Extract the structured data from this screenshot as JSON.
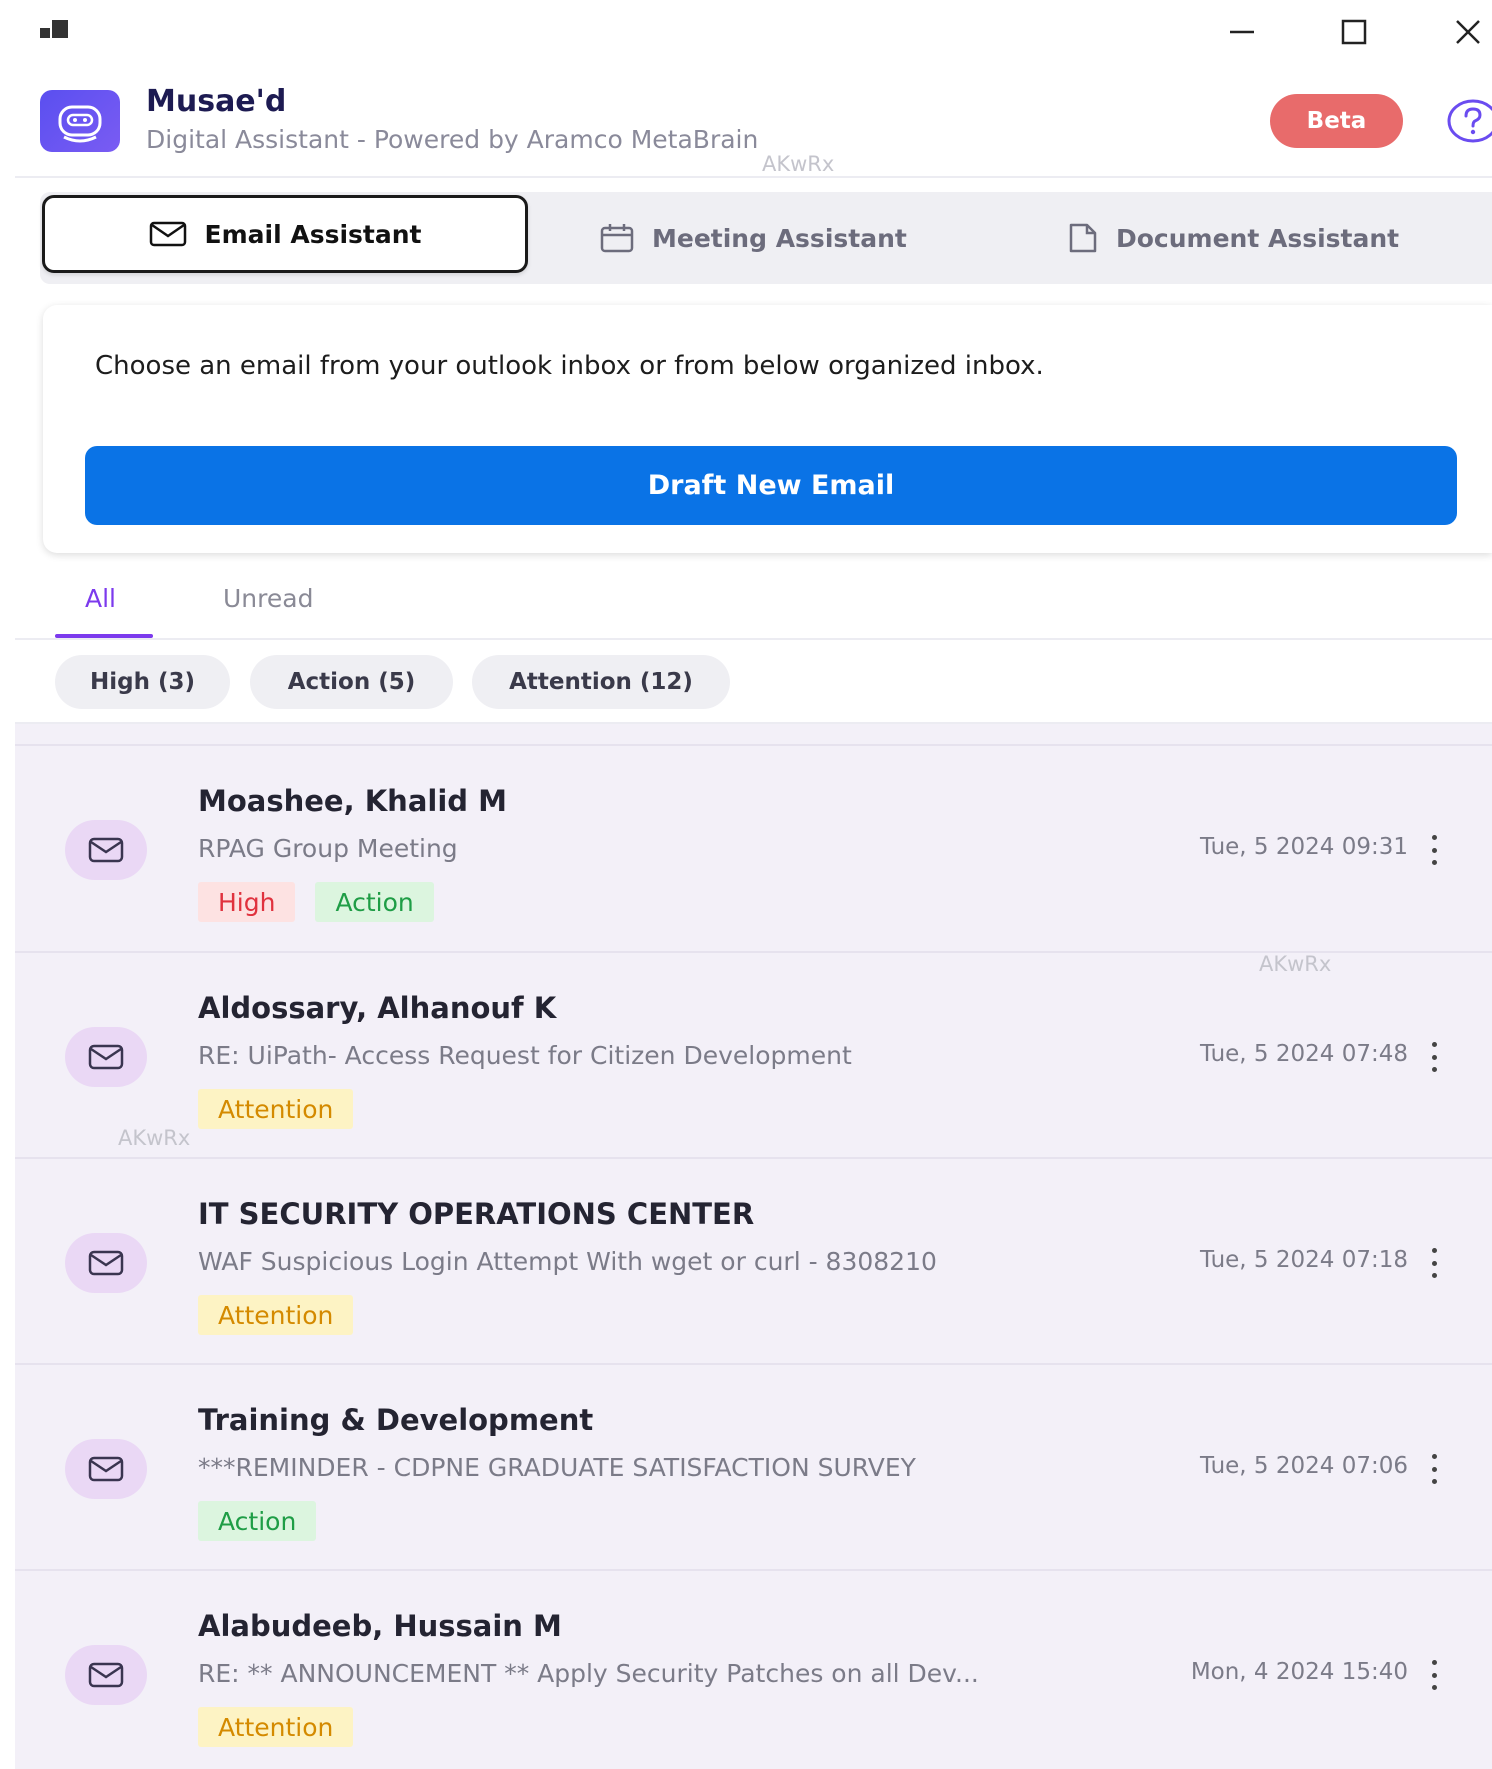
{
  "window": {
    "controls": {
      "minimize": "minimize-icon",
      "maximize": "maximize-icon",
      "close": "close-icon"
    }
  },
  "header": {
    "app_name": "Musae'd",
    "subtitle": "Digital Assistant - Powered by Aramco MetaBrain",
    "watermark": "AKwRx",
    "beta_label": "Beta",
    "help_icon": "help-circle-icon"
  },
  "tabs": [
    {
      "label": "Email Assistant",
      "icon": "mail-icon",
      "active": true
    },
    {
      "label": "Meeting Assistant",
      "icon": "calendar-icon",
      "active": false
    },
    {
      "label": "Document Assistant",
      "icon": "document-icon",
      "active": false
    }
  ],
  "intro": {
    "text": "Choose an email from your outlook inbox or from below organized inbox.",
    "draft_button": "Draft New Email"
  },
  "filters": {
    "tabs": [
      {
        "label": "All",
        "active": true
      },
      {
        "label": "Unread",
        "active": false
      }
    ],
    "chips": [
      "High (3)",
      "Action (5)",
      "Attention (12)"
    ]
  },
  "emails": [
    {
      "sender": "Moashee, Khalid M",
      "subject": "RPAG Group Meeting",
      "date": "Tue, 5 2024 09:31",
      "tags": [
        "High",
        "Action"
      ]
    },
    {
      "sender": "Aldossary, Alhanouf K",
      "subject": "RE: UiPath- Access Request for Citizen Development",
      "date": "Tue, 5 2024 07:48",
      "tags": [
        "Attention"
      ]
    },
    {
      "sender": "IT SECURITY OPERATIONS CENTER",
      "subject": "WAF Suspicious Login Attempt With wget or curl - 8308210",
      "date": "Tue, 5 2024 07:18",
      "tags": [
        "Attention"
      ]
    },
    {
      "sender": "Training & Development",
      "subject": "***REMINDER - CDPNE GRADUATE SATISFACTION SURVEY",
      "date": "Tue, 5 2024 07:06",
      "tags": [
        "Action"
      ]
    },
    {
      "sender": "Alabudeeb, Hussain M",
      "subject": "RE: ** ANNOUNCEMENT ** Apply Security Patches on all Dev...",
      "date": "Mon, 4 2024 15:40",
      "tags": [
        "Attention"
      ]
    }
  ],
  "colors": {
    "accent": "#7c3aed",
    "primary_button": "#0a73e6",
    "beta": "#e86b6b",
    "list_background": "#f3f0f8",
    "tag_high": "#e0323e",
    "tag_action": "#1f9d46",
    "tag_attention": "#d48a00"
  }
}
